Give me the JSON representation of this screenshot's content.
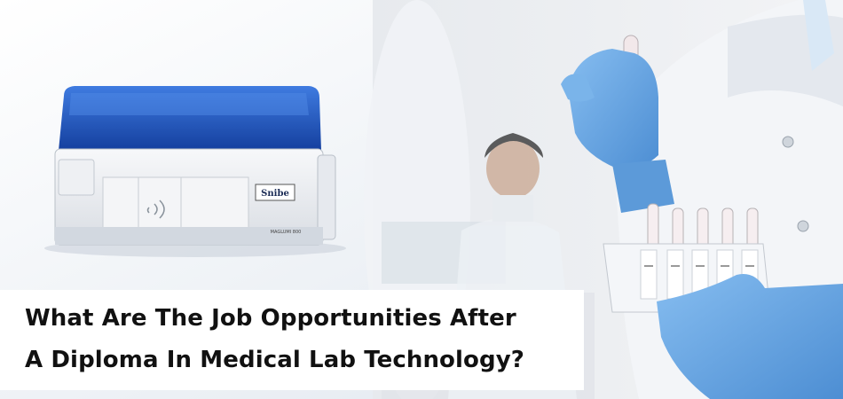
{
  "headline": {
    "line1": "What Are The Job Opportunities After",
    "line2": "A Diploma In Medical Lab Technology?"
  },
  "device": {
    "brand_label": "Snibe",
    "model_label": "MAGLUMI 800"
  },
  "colors": {
    "device_lid": "#1f4fbf",
    "glove": "#6aa7e2",
    "blood": "#8a1020",
    "headline_text": "#111111"
  }
}
